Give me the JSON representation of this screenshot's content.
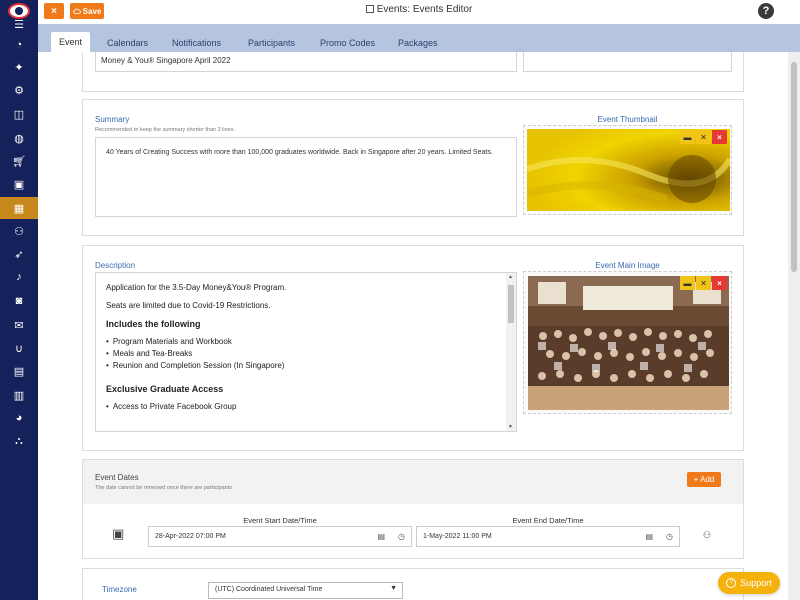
{
  "window": {
    "title": "Events: Events Editor",
    "save_label": "Save",
    "close_label": "×",
    "help_label": "?"
  },
  "tabs": [
    "Event",
    "Calendars",
    "Notifications",
    "Participants",
    "Promo Codes",
    "Packages"
  ],
  "event": {
    "name_value": "Money & You® Singapore April 2022"
  },
  "summary": {
    "label": "Summary",
    "hint": "Recommended to keep the summary shorter than 3 lines.",
    "text": "40 Years of Creating Success with more than 100,000 graduates worldwide. Back in Singapore after 20 years. Limited Seats.",
    "thumbnail_label": "Event Thumbnail"
  },
  "description": {
    "label": "Description",
    "main_image_label": "Event Main Image",
    "p1": "Application for the 3.5-Day Money&You® Program.",
    "p2": "Seats are limited due to Covid-19 Restrictions.",
    "h1": "Includes the following",
    "items1": [
      "Program Materials and Workbook",
      "Meals and Tea-Breaks",
      "Reunion and Completion Session (In Singapore)"
    ],
    "h2": "Exclusive Graduate Access",
    "items2": [
      "Access to Private Facebook Group"
    ]
  },
  "dates": {
    "label": "Event Dates",
    "hint": "The date cannot be removed once there are participants",
    "add_label": "+ Add",
    "start_label": "Event Start Date/Time",
    "start_value": "28-Apr-2022 07:00 PM",
    "end_label": "Event End Date/Time",
    "end_value": "1-May-2022 11:00 PM"
  },
  "timezone": {
    "label": "Timezone",
    "value": "(UTC) Coordinated Universal Time"
  },
  "support": {
    "label": "Support"
  },
  "colors": {
    "sidebar": "#14215a",
    "accent": "#f07a1a",
    "tabbar": "#b5c5e0",
    "label_blue": "#3a6ab0",
    "support": "#f5b20d"
  }
}
